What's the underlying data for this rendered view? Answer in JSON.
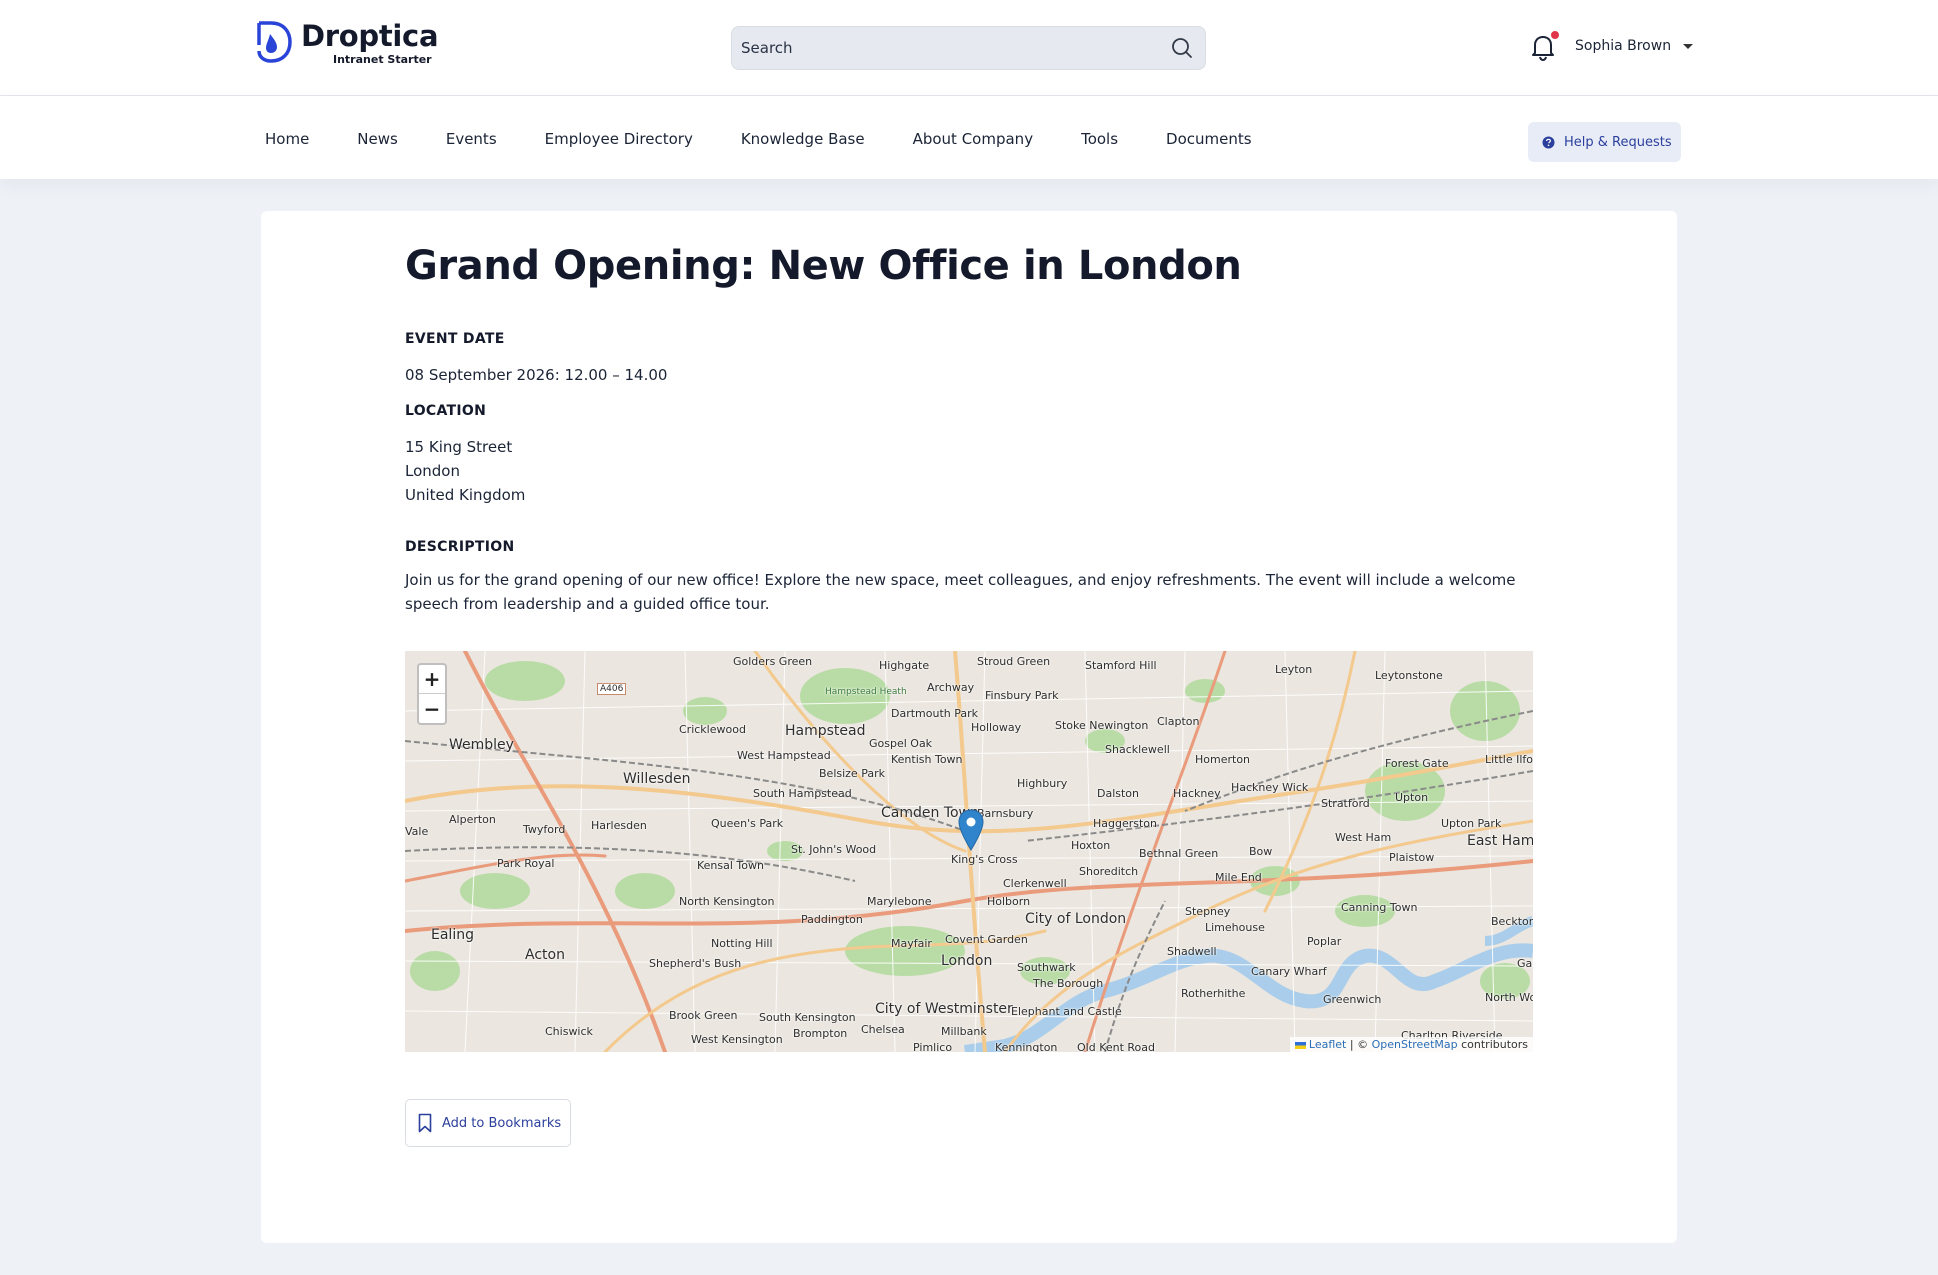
{
  "brand": {
    "name": "Droptica",
    "subtitle": "Intranet Starter",
    "color": "#2b44d8"
  },
  "search": {
    "placeholder": "Search"
  },
  "user": {
    "name": "Sophia Brown"
  },
  "nav": {
    "items": [
      "Home",
      "News",
      "Events",
      "Employee Directory",
      "Knowledge Base",
      "About Company",
      "Tools",
      "Documents"
    ],
    "help_label": "Help & Requests"
  },
  "event": {
    "title": "Grand Opening: New Office in London",
    "date_label": "EVENT DATE",
    "date_value": "08 September 2026: 12.00 – 14.00",
    "location_label": "LOCATION",
    "location_lines": [
      "15 King Street",
      "London",
      "United Kingdom"
    ],
    "description_label": "DESCRIPTION",
    "description": "Join us for the grand opening of our new office! Explore the new space, meet colleagues, and enjoy refreshments. The event will include a welcome speech from leadership and a guided office tour."
  },
  "map": {
    "zoom_in": "+",
    "zoom_out": "−",
    "attribution_leaflet": "Leaflet",
    "attribution_sep": " | © ",
    "attribution_osm": "OpenStreetMap",
    "attribution_tail": " contributors",
    "labels": [
      "Golders Green",
      "Highgate",
      "Stroud Green",
      "Stamford Hill",
      "Leyton",
      "Leytonstone",
      "Hampstead Heath",
      "Archway",
      "Finsbury Park",
      "Dartmouth Park",
      "Cricklewood",
      "Hampstead",
      "Gospel Oak",
      "Holloway",
      "Stoke Newington",
      "Clapton",
      "Wembley",
      "West Hampstead",
      "Kentish Town",
      "Shacklewell",
      "Homerton",
      "Willesden",
      "Belsize Park",
      "Highbury",
      "Forest Gate",
      "Little Ilford",
      "South Hampstead",
      "Dalston",
      "Hackney",
      "Hackney Wick",
      "Stratford",
      "Upton",
      "Camden Town",
      "Barnsbury",
      "Alperton",
      "Twyford",
      "Harlesden",
      "Queen's Park",
      "Haggerston",
      "Upton Park",
      "Vale",
      "St. John's Wood",
      "King's Cross",
      "Hoxton",
      "West Ham",
      "East Ham",
      "Park Royal",
      "Kensal Town",
      "Bethnal Green",
      "Bow",
      "Plaistow",
      "Shoreditch",
      "Clerkenwell",
      "Mile End",
      "North Kensington",
      "Marylebone",
      "Holborn",
      "Paddington",
      "City of London",
      "Stepney",
      "Canning Town",
      "Beckton",
      "Ealing",
      "Limehouse",
      "Notting Hill",
      "Mayfair",
      "Covent Garden",
      "Poplar",
      "Acton",
      "Shadwell",
      "London",
      "Shepherd's Bush",
      "Southwark",
      "Canary Wharf",
      "The Borough",
      "Rotherhithe",
      "City of Westminster",
      "Greenwich",
      "North Woolwich",
      "Brook Green",
      "South Kensington",
      "Elephant and Castle",
      "Chiswick",
      "Brompton",
      "Chelsea",
      "Millbank",
      "West Kensington",
      "Pimlico",
      "Kennington",
      "Old Kent Road",
      "Charlton Riverside",
      "A406",
      "Gallions"
    ]
  },
  "bookmark_label": "Add to Bookmarks",
  "colors": {
    "page_bg": "#eef1f6",
    "accent": "#2b3f9c",
    "marker": "#2f84cc",
    "notification": "#e0364a"
  }
}
